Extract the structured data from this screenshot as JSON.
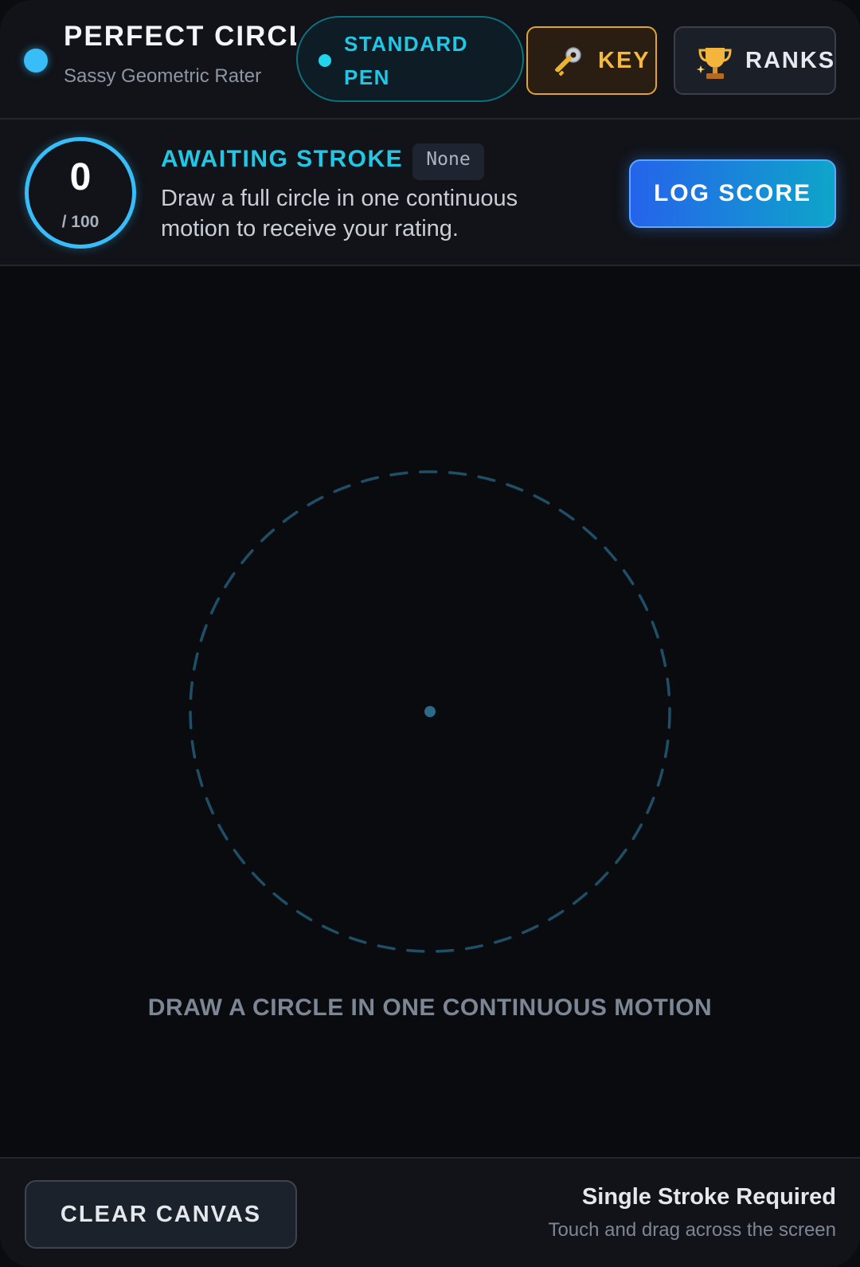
{
  "header": {
    "title": "PERFECT CIRCLE",
    "subtitle": "Sassy Geometric Rater",
    "pen_mode": "STANDARD PEN",
    "key_label": "KEY",
    "ranks_label": "RANKS"
  },
  "status": {
    "score": "0",
    "score_max": "/ 100",
    "title": "AWAITING STROKE",
    "grade": "None",
    "description": "Draw a full circle in one continuous motion to receive your rating.",
    "log_label": "LOG SCORE"
  },
  "canvas": {
    "hint": "DRAW A CIRCLE IN ONE CONTINUOUS MOTION"
  },
  "footer": {
    "clear_label": "CLEAR CANVAS",
    "title": "Single Stroke Required",
    "subtitle": "Touch and drag across the screen"
  },
  "icons": {
    "status": "status-dot-icon",
    "pen": "pen-dot-icon",
    "key": "key-icon",
    "ranks": "trophy-icon"
  },
  "colors": {
    "accent": "#38bdf8",
    "pen_accent": "#22c7e6",
    "key_gold": "#f5b93d",
    "log_gradient_start": "#2563eb",
    "log_gradient_end": "#0ea5c9",
    "guide_circle": "#1e4f66"
  }
}
